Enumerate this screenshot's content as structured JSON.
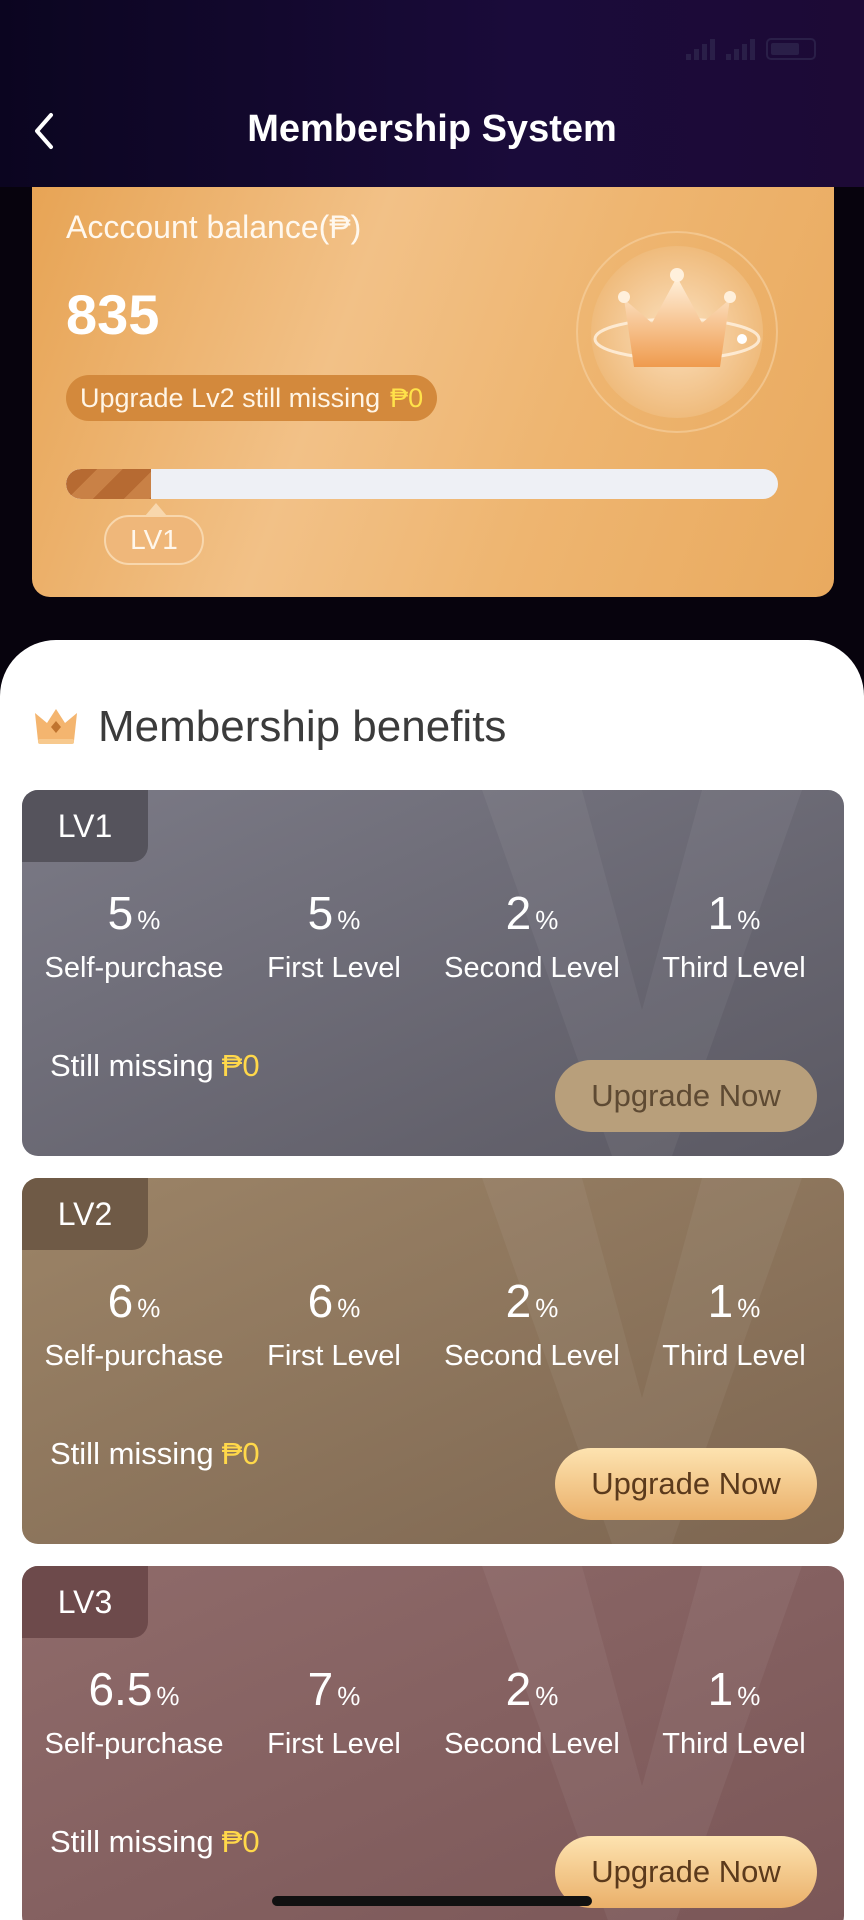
{
  "status_bar": {
    "time": ""
  },
  "header": {
    "title": "Membership System"
  },
  "balance_card": {
    "label": "Acccount balance(₱)",
    "value": "835",
    "upgrade_text": "Upgrade Lv2 still missing",
    "upgrade_amount": "₱0",
    "progress_percent": 12,
    "current_level": "LV1"
  },
  "benefits": {
    "heading": "Membership benefits",
    "levels": [
      {
        "tab": "LV1",
        "stats": [
          {
            "value": "5",
            "unit": "%",
            "label": "Self-purchase"
          },
          {
            "value": "5",
            "unit": "%",
            "label": "First Level"
          },
          {
            "value": "2",
            "unit": "%",
            "label": "Second Level"
          },
          {
            "value": "1",
            "unit": "%",
            "label": "Third Level"
          }
        ],
        "missing_label": "Still missing",
        "missing_amount": "₱0",
        "button": "Upgrade Now",
        "color_top": "#7b7a86",
        "color_bottom": "#5b5963",
        "tab_color": "#55535c"
      },
      {
        "tab": "LV2",
        "stats": [
          {
            "value": "6",
            "unit": "%",
            "label": "Self-purchase"
          },
          {
            "value": "6",
            "unit": "%",
            "label": "First Level"
          },
          {
            "value": "2",
            "unit": "%",
            "label": "Second Level"
          },
          {
            "value": "1",
            "unit": "%",
            "label": "Third Level"
          }
        ],
        "missing_label": "Still missing",
        "missing_amount": "₱0",
        "button": "Upgrade Now",
        "color_top": "#9c8467",
        "color_bottom": "#7d6651",
        "tab_color": "#6f5a46"
      },
      {
        "tab": "LV3",
        "stats": [
          {
            "value": "6.5",
            "unit": "%",
            "label": "Self-purchase"
          },
          {
            "value": "7",
            "unit": "%",
            "label": "First Level"
          },
          {
            "value": "2",
            "unit": "%",
            "label": "Second Level"
          },
          {
            "value": "1",
            "unit": "%",
            "label": "Third Level"
          }
        ],
        "missing_label": "Still missing",
        "missing_amount": "₱0",
        "button": "Upgrade Now",
        "color_top": "#8f6b6a",
        "color_bottom": "#7a5657",
        "tab_color": "#6d4a4b"
      }
    ]
  }
}
